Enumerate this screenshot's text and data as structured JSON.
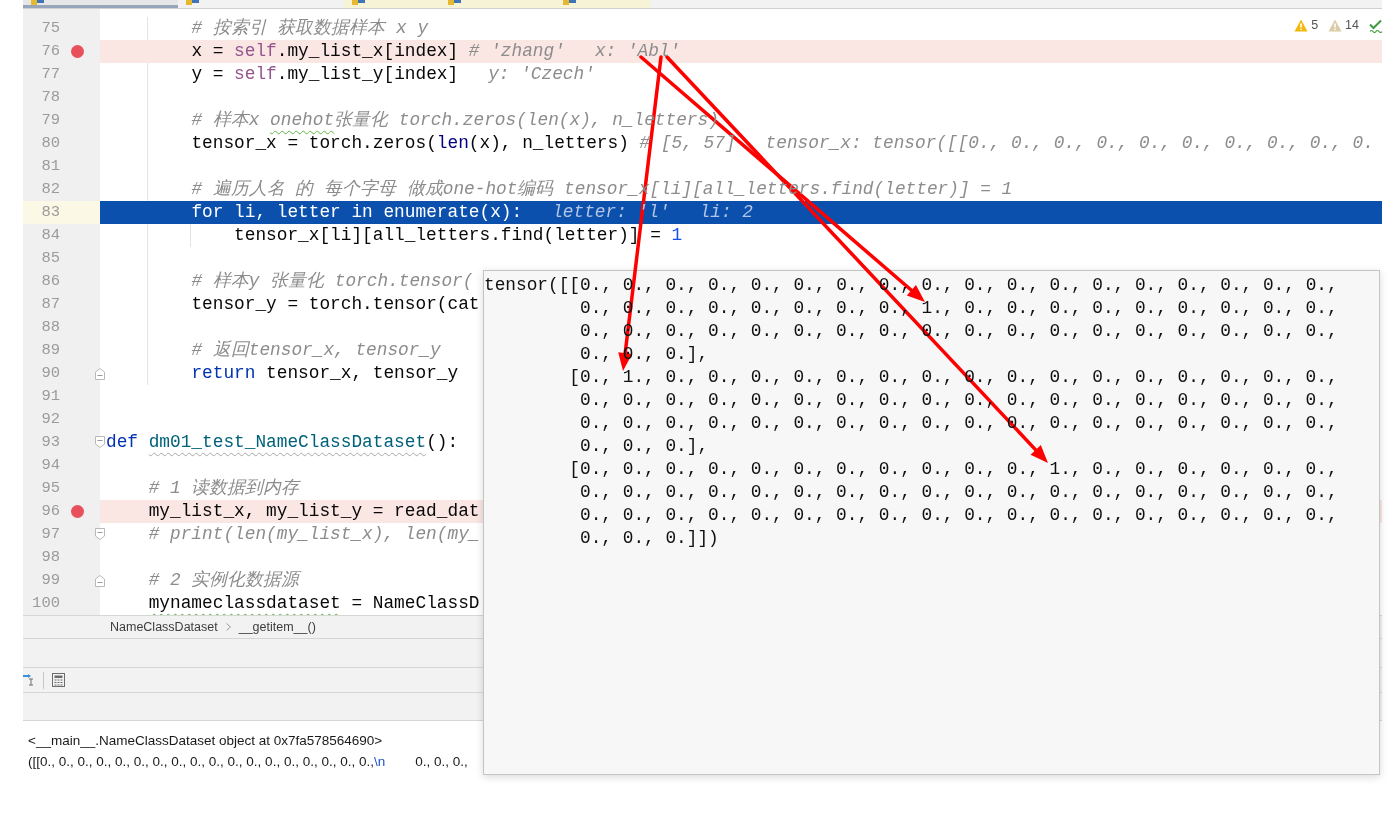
{
  "editor_tabs": [
    {
      "selected": true,
      "color": "#e6e6e6"
    },
    {
      "selected": false,
      "color": "#f2f2f2"
    },
    {
      "selected": false,
      "color": "#f6f3d6"
    },
    {
      "selected": false,
      "color": "#f6f3d6"
    },
    {
      "selected": false,
      "color": "#f6f3d6"
    }
  ],
  "inspections": [
    {
      "kind": "warning",
      "count": "5"
    },
    {
      "kind": "weak_warning",
      "count": "14"
    },
    {
      "kind": "typo"
    }
  ],
  "code_lines": [
    {
      "number": "75",
      "kind": "code",
      "breakpoint": false,
      "current": false,
      "segments": [
        {
          "kind": "comment",
          "text": "        # 按索引 获取数据样本 x y"
        }
      ]
    },
    {
      "number": "76",
      "kind": "code",
      "breakpoint": true,
      "current": false,
      "segments": [
        {
          "kind": "plain",
          "text": "        x = "
        },
        {
          "kind": "self",
          "text": "self"
        },
        {
          "kind": "plain",
          "text": ".my_list_x[index]"
        },
        {
          "kind": "comment",
          "text": " # 'zhang'"
        },
        {
          "kind": "inline_value",
          "text": "x: 'Abl'"
        }
      ]
    },
    {
      "number": "77",
      "kind": "code",
      "breakpoint": false,
      "current": false,
      "segments": [
        {
          "kind": "plain",
          "text": "        y = "
        },
        {
          "kind": "self",
          "text": "self"
        },
        {
          "kind": "plain",
          "text": ".my_list_y[index]"
        },
        {
          "kind": "inline_value",
          "text": "y: 'Czech'"
        }
      ]
    },
    {
      "number": "78",
      "kind": "code",
      "breakpoint": false,
      "current": false
    },
    {
      "number": "79",
      "kind": "code",
      "breakpoint": false,
      "current": false,
      "segments": [
        {
          "kind": "comment",
          "text": "        # 样本x "
        },
        {
          "kind": "comment_typo",
          "text": "onehot"
        },
        {
          "kind": "comment",
          "text": "张量化 torch.zeros(len(x), n_letters)"
        }
      ]
    },
    {
      "number": "80",
      "kind": "code",
      "breakpoint": false,
      "current": false,
      "segments": [
        {
          "kind": "plain",
          "text": "        tensor_x = torch.zeros("
        },
        {
          "kind": "builtin",
          "text": "len"
        },
        {
          "kind": "plain",
          "text": "(x), n_letters)"
        },
        {
          "kind": "comment",
          "text": " # [5, 57]"
        },
        {
          "kind": "inline_value",
          "text": "tensor_x: tensor([[0., 0., 0., 0., 0., 0., 0., 0., 0., 0."
        }
      ]
    },
    {
      "number": "81",
      "kind": "code",
      "breakpoint": false,
      "current": false
    },
    {
      "number": "82",
      "kind": "code",
      "breakpoint": false,
      "current": false,
      "segments": [
        {
          "kind": "comment",
          "text": "        # 遍历人名 的 每个字母 做成one-hot编码 tensor_x[li][all_letters.find(letter)] = 1"
        }
      ]
    },
    {
      "number": "83",
      "kind": "code",
      "breakpoint": false,
      "current": true,
      "segments": [
        {
          "kind": "keyword",
          "text": "        for"
        },
        {
          "kind": "plain",
          "text": " li, letter "
        },
        {
          "kind": "keyword",
          "text": "in"
        },
        {
          "kind": "plain",
          "text": " enumerate(x):"
        },
        {
          "kind": "inline_value",
          "text": "letter: 'l'"
        },
        {
          "kind": "inline_value",
          "text": "li: 2"
        }
      ]
    },
    {
      "number": "84",
      "kind": "code",
      "breakpoint": false,
      "current": false,
      "segments": [
        {
          "kind": "plain",
          "text": "            tensor_x[li][all_letters.find(letter)] = "
        },
        {
          "kind": "number",
          "text": "1"
        }
      ]
    },
    {
      "number": "85",
      "kind": "code",
      "breakpoint": false,
      "current": false
    },
    {
      "number": "86",
      "kind": "code",
      "breakpoint": false,
      "current": false,
      "segments": [
        {
          "kind": "comment",
          "text": "        # 样本y 张量化 torch.tensor("
        }
      ]
    },
    {
      "number": "87",
      "kind": "code",
      "breakpoint": false,
      "current": false,
      "segments": [
        {
          "kind": "plain",
          "text": "        tensor_y = torch.tensor(cat"
        }
      ]
    },
    {
      "number": "88",
      "kind": "code",
      "breakpoint": false,
      "current": false
    },
    {
      "number": "89",
      "kind": "code",
      "breakpoint": false,
      "current": false,
      "segments": [
        {
          "kind": "comment",
          "text": "        # 返回tensor_x, tensor_y"
        }
      ]
    },
    {
      "number": "90",
      "kind": "fold_end",
      "breakpoint": false,
      "current": false,
      "segments": [
        {
          "kind": "keyword",
          "text": "        return"
        },
        {
          "kind": "plain",
          "text": " tensor_x, tensor_y"
        }
      ]
    },
    {
      "number": "91",
      "kind": "code",
      "breakpoint": false,
      "current": false
    },
    {
      "number": "92",
      "kind": "code",
      "breakpoint": false,
      "current": false
    },
    {
      "number": "93",
      "kind": "fold_start",
      "breakpoint": false,
      "current": false,
      "segments": [
        {
          "kind": "keyword",
          "text": "def "
        },
        {
          "kind": "func_unused",
          "text": "dm01_test_NameClassDataset"
        },
        {
          "kind": "plain",
          "text": "():"
        }
      ]
    },
    {
      "number": "94",
      "kind": "code",
      "breakpoint": false,
      "current": false
    },
    {
      "number": "95",
      "kind": "code",
      "breakpoint": false,
      "current": false,
      "segments": [
        {
          "kind": "comment",
          "text": "    # 1 读数据到内存"
        }
      ]
    },
    {
      "number": "96",
      "kind": "code",
      "breakpoint": true,
      "current": false,
      "segments": [
        {
          "kind": "plain",
          "text": "    my_list_x, my_list_y = read_dat"
        }
      ]
    },
    {
      "number": "97",
      "kind": "fold_start",
      "breakpoint": false,
      "current": false,
      "segments": [
        {
          "kind": "comment",
          "text": "    # print(len(my_list_x), len(my_"
        }
      ]
    },
    {
      "number": "98",
      "kind": "code",
      "breakpoint": false,
      "current": false
    },
    {
      "number": "99",
      "kind": "fold_end",
      "breakpoint": false,
      "current": false,
      "segments": [
        {
          "kind": "comment",
          "text": "    # 2 实例化数据源"
        }
      ]
    },
    {
      "number": "100",
      "kind": "code",
      "breakpoint": false,
      "current": false,
      "segments": [
        {
          "kind": "plain_typo",
          "text": "    mynameclassdataset"
        },
        {
          "kind": "plain",
          "text": " = NameClassD"
        }
      ]
    }
  ],
  "breadcrumbs": [
    "NameClassDataset",
    "__getitem__()"
  ],
  "console_lines": [
    [
      {
        "kind": "plain",
        "text": "<__main__.NameClassDataset object at 0x7fa578564690>"
      }
    ],
    [
      {
        "kind": "plain",
        "text": "([[0., 0., 0., 0., 0., 0., 0., 0., 0., 0., 0., 0., 0., 0., 0., 0., 0., 0.,"
      },
      {
        "kind": "escape",
        "text": "\\n"
      },
      {
        "kind": "plain",
        "text": "        0., 0., 0.,"
      }
    ]
  ],
  "value_popup": {
    "lines": [
      {
        "kind": "open",
        "text": "tensor([[0., 0., 0., 0., 0., 0., 0., 0., 0., 0., 0., 0., 0., 0., 0., 0., 0., 0.,"
      },
      {
        "kind": "continuation",
        "text": "0., 0., 0., 0., 0., 0., 0., 0., 1., 0., 0., 0., 0., 0., 0., 0., 0., 0.,"
      },
      {
        "kind": "continuation",
        "text": "0., 0., 0., 0., 0., 0., 0., 0., 0., 0., 0., 0., 0., 0., 0., 0., 0., 0.,"
      },
      {
        "kind": "continuation",
        "text": "0., 0., 0.],"
      },
      {
        "kind": "row",
        "text": "[0., 1., 0., 0., 0., 0., 0., 0., 0., 0., 0., 0., 0., 0., 0., 0., 0., 0.,"
      },
      {
        "kind": "continuation",
        "text": "0., 0., 0., 0., 0., 0., 0., 0., 0., 0., 0., 0., 0., 0., 0., 0., 0., 0.,"
      },
      {
        "kind": "continuation",
        "text": "0., 0., 0., 0., 0., 0., 0., 0., 0., 0., 0., 0., 0., 0., 0., 0., 0., 0.,"
      },
      {
        "kind": "continuation",
        "text": "0., 0., 0.],"
      },
      {
        "kind": "row",
        "text": "[0., 0., 0., 0., 0., 0., 0., 0., 0., 0., 0., 1., 0., 0., 0., 0., 0., 0.,"
      },
      {
        "kind": "continuation",
        "text": "0., 0., 0., 0., 0., 0., 0., 0., 0., 0., 0., 0., 0., 0., 0., 0., 0., 0.,"
      },
      {
        "kind": "continuation",
        "text": "0., 0., 0., 0., 0., 0., 0., 0., 0., 0., 0., 0., 0., 0., 0., 0., 0., 0.,"
      },
      {
        "kind": "continuation",
        "text": "0., 0., 0.]])"
      }
    ]
  }
}
